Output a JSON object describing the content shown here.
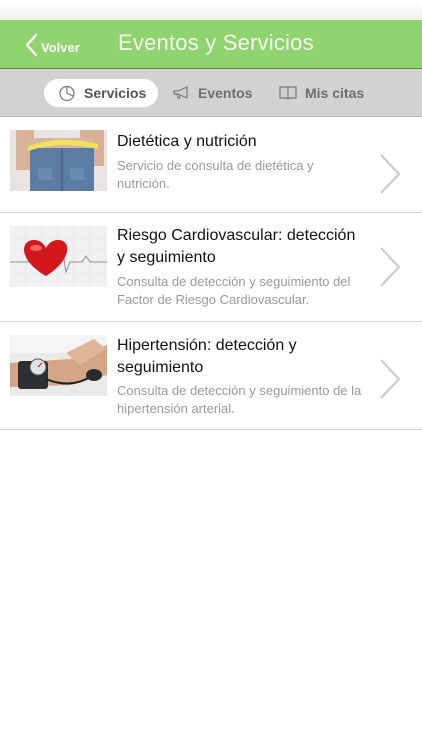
{
  "navbar": {
    "back_label": "Volver",
    "title": "Eventos y Servicios"
  },
  "segments": [
    {
      "label": "Servicios",
      "icon": "pie-chart-icon",
      "active": true
    },
    {
      "label": "Eventos",
      "icon": "megaphone-icon",
      "active": false
    },
    {
      "label": "Mis citas",
      "icon": "book-icon",
      "active": false
    }
  ],
  "services": [
    {
      "title": "Dietética y nutrición",
      "description": "Servicio de consulta de dietética y nutrición.",
      "image": "measuring-tape-waist-photo"
    },
    {
      "title": "Riesgo Cardiovascular: detección y seguimiento",
      "description": "Consulta de detección y seguimiento del Factor de Riesgo Cardiovascular.",
      "image": "heart-ecg-photo"
    },
    {
      "title": "Hipertensión: detección y seguimiento",
      "description": "Consulta de detección y seguimiento de la hipertensión arterial.",
      "image": "blood-pressure-photo"
    }
  ],
  "colors": {
    "nav_green": "#8fd46f",
    "segment_bar": "#d2d2d2"
  }
}
